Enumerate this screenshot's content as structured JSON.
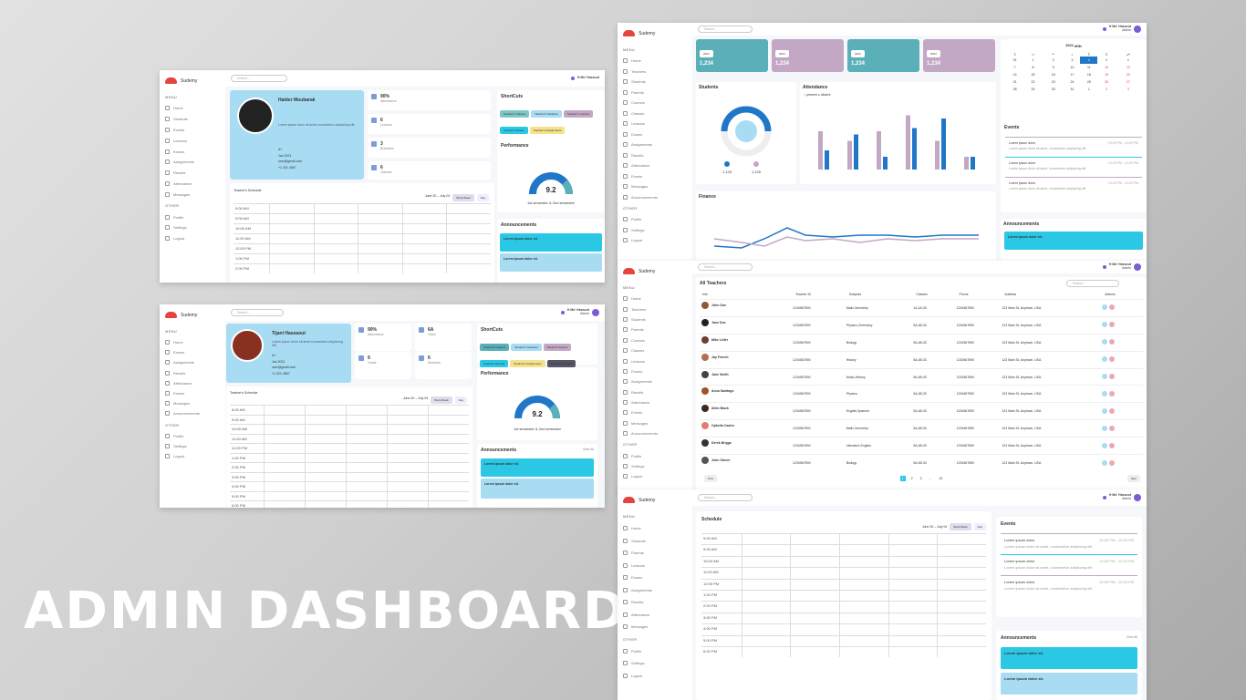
{
  "headline": "ADMIN DASHBOARD",
  "brand": "Sudemy",
  "search_ph": "Search...",
  "user": {
    "name": "H Mo' Hassout",
    "role": "Admin"
  },
  "menu_label": "MENU",
  "other_label": "OTHER",
  "teacher_menu": [
    "Home",
    "Students",
    "Events",
    "Lessons",
    "Exams",
    "Assignments",
    "Results",
    "Attendance",
    "Messages"
  ],
  "student_menu": [
    "Home",
    "Exams",
    "Assignments",
    "Results",
    "Attendance",
    "Exams",
    "Messages",
    "Announcements"
  ],
  "admin_menu": [
    "Home",
    "Teachers",
    "Students",
    "Parents",
    "Courses",
    "Classes",
    "Lessons",
    "Exams",
    "Assignments",
    "Results",
    "Attendance",
    "Events",
    "Messages",
    "Announcements"
  ],
  "other_menu": [
    "Profile",
    "Settings",
    "Logout"
  ],
  "s1": {
    "name": "Haider Moubarak",
    "desc": "Lorem ipsum dolor sit amet consectetur adipiscing elit.",
    "blood": "A+",
    "date": "Jan 2021",
    "email": "user@gmail.com",
    "phone": "+1 321 4567",
    "stats": [
      {
        "v": "90%",
        "l": "Attendance"
      },
      {
        "v": "6",
        "l": "Lessons"
      },
      {
        "v": "3",
        "l": "Branches"
      },
      {
        "v": "6",
        "l": "Classes"
      }
    ],
    "shortcuts": [
      "Teacher's Classes",
      "Teacher's Students",
      "Teacher's Lessons",
      "Teacher's Exams",
      "Teacher's Assignments"
    ],
    "perf_title": "Performance",
    "score": "9.2",
    "score_sub": "1st semester & 2nd semester",
    "sched_title": "Teacher's Schedule",
    "range": "June 30 – July 04",
    "work_week": "Work Week",
    "day": "Day",
    "times": [
      "9:00 AM",
      "9:00 AM",
      "10:00 AM",
      "11:00 AM",
      "12:00 PM",
      "1:00 PM",
      "2:00 PM"
    ],
    "ann_title": "Announcements",
    "ann": [
      "Lorem ipsum dolor sit.",
      "Lorem ipsum dolor sit."
    ],
    "ann_desc": "Lorem ipsum dolor sit amet consectetur adipiscing elit. Nisi sed dictum"
  },
  "s2": {
    "name": "Tijani Hassaout",
    "blood": "A+",
    "date": "Jan 2021",
    "email": "user@gmail.com",
    "phone": "+1 321 4567",
    "stats": [
      {
        "v": "90%",
        "l": "Attendance"
      },
      {
        "v": "6A",
        "l": "Class"
      },
      {
        "v": "9",
        "l": "Grade"
      },
      {
        "v": "6",
        "l": "Students"
      }
    ],
    "shortcuts": [
      "Student's Lessons",
      "Student's Teachers",
      "Student's Exams",
      "Student's Results",
      "Student's Assignments",
      "Student's Classes"
    ],
    "times": [
      "8:00 AM",
      "9:00 AM",
      "10:00 AM",
      "11:00 AM",
      "12:00 PM",
      "1:00 PM",
      "2:00 PM",
      "3:00 PM",
      "4:00 PM",
      "5:00 PM",
      "6:00 PM"
    ],
    "view_all": "View All"
  },
  "s3": {
    "counts": [
      "1,234",
      "1,234",
      "1,234",
      "1,234"
    ],
    "students_title": "Students",
    "attend_title": "Attendance",
    "boys": "1,125",
    "girls": "1,125",
    "present": "present",
    "absent": "absent",
    "att": [
      [
        60,
        30
      ],
      [
        45,
        55
      ],
      [
        60,
        20
      ],
      [
        85,
        65
      ],
      [
        45,
        80
      ],
      [
        20,
        20
      ]
    ],
    "fin_title": "Finance",
    "fin_legend": [
      "income",
      "expense"
    ],
    "cal_title": "2021 يونيو",
    "days": [
      "ح",
      "ن",
      "ث",
      "ر",
      "خ",
      "ج",
      "س"
    ],
    "cal": [
      [
        "31",
        "1",
        "2",
        "3",
        "4",
        "5",
        "6"
      ],
      [
        "7",
        "8",
        "9",
        "10",
        "11",
        "12",
        "13"
      ],
      [
        "14",
        "15",
        "16",
        "17",
        "18",
        "19",
        "20"
      ],
      [
        "21",
        "22",
        "23",
        "24",
        "25",
        "26",
        "27"
      ],
      [
        "28",
        "29",
        "30",
        "31",
        "1",
        "2",
        "3"
      ]
    ],
    "events_title": "Events",
    "event_item": "Lorem ipsum dolor",
    "event_desc": "Lorem ipsum dolor sit amet, consectetur adipiscing elit",
    "event_time": "10:00 PM - 12:00 PM",
    "ann_title": "Announcements",
    "ann_item": "Lorem ipsum dolor sit.",
    "ann_date": "2025-01-01"
  },
  "s4": {
    "title": "All Teachers",
    "cols": [
      "Info",
      "Teacher ID",
      "Subjects",
      "Classes",
      "Phone",
      "Address",
      "Actions"
    ],
    "rows": [
      [
        "John Doe",
        "1234567890",
        "Math,Geometry",
        "1A,2A,3C",
        "1234567890",
        "123 Main St, Anytown, USA"
      ],
      [
        "Jane Doe",
        "1234567890",
        "Physics,Chemistry",
        "5A,4B,3C",
        "1234567890",
        "123 Main St, Anytown, USA"
      ],
      [
        "Mike Leller",
        "1234567890",
        "Biology",
        "5A,4B,3C",
        "1234567890",
        "123 Main St, Anytown, USA"
      ],
      [
        "Jay French",
        "1234567890",
        "History",
        "5A,4B,3C",
        "1234567890",
        "123 Main St, Anytown, USA"
      ],
      [
        "Jane Smith",
        "1234567890",
        "Music,History",
        "5A,4B,3C",
        "1234567890",
        "123 Main St, Anytown, USA"
      ],
      [
        "Anna Santiago",
        "1234567890",
        "Physics",
        "5A,4B,3C",
        "1234567890",
        "123 Main St, Anytown, USA"
      ],
      [
        "Allen Black",
        "1234567890",
        "English,Spanish",
        "5A,4B,3C",
        "1234567890",
        "123 Main St, Anytown, USA"
      ],
      [
        "Ophelia Castro",
        "1234567890",
        "Math,Geometry",
        "5A,4B,3C",
        "1234567890",
        "123 Main St, Anytown, USA"
      ],
      [
        "Derek Briggs",
        "1234567890",
        "Literature,English",
        "5A,4B,3C",
        "1234567890",
        "123 Main St, Anytown, USA"
      ],
      [
        "John Glover",
        "1234567890",
        "Biology",
        "5A,4B,3C",
        "1234567890",
        "123 Main St, Anytown, USA"
      ]
    ],
    "prev": "Prev",
    "next": "Next",
    "pages": [
      "1",
      "2",
      "3",
      "...",
      "10"
    ]
  },
  "s5": {
    "title": "Schedule",
    "range": "June 30 – July 04",
    "work_week": "Work Week",
    "day": "Day",
    "times": [
      "9:00 AM",
      "9:00 AM",
      "10:00 AM",
      "11:00 AM",
      "12:00 PM",
      "1:00 PM",
      "2:00 PM",
      "3:00 PM",
      "4:00 PM",
      "5:00 PM",
      "6:00 PM"
    ],
    "menu": [
      "Home",
      "Students",
      "Parents",
      "Lessons",
      "Exams",
      "Assignments",
      "Results",
      "Attendance",
      "Messages"
    ],
    "events_title": "Events",
    "ann_title": "Announcements",
    "view_all": "View All",
    "ann_item": "Lorem ipsum dolor sit.",
    "ann_desc": "Lorem ipsum dolor sit amet consectetur adipiscing elit. Nisi sed dictum",
    "ann_date": "2025-01-01"
  },
  "colors": {
    "teal": "#5aafb8",
    "mauve": "#c3a8c5",
    "blue": "#2077c8",
    "sky": "#a7dcf3",
    "cyan": "#2bc8e6"
  }
}
